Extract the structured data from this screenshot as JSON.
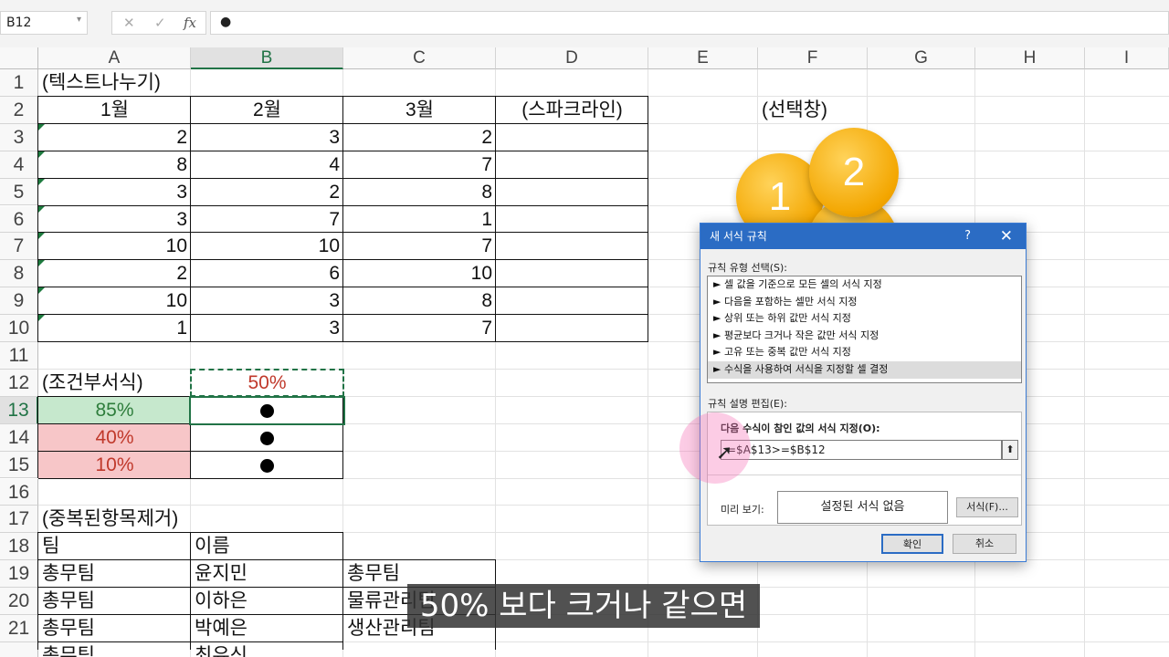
{
  "formula_bar": {
    "name_box": "B12",
    "cancel_icon": "✕",
    "enter_icon": "✓",
    "fx_label": "fx",
    "content": "●"
  },
  "columns": [
    "A",
    "B",
    "C",
    "D",
    "E",
    "F",
    "G",
    "H",
    "I"
  ],
  "rows": [
    "1",
    "2",
    "3",
    "4",
    "5",
    "6",
    "7",
    "8",
    "9",
    "10",
    "11",
    "12",
    "13",
    "14",
    "15",
    "16",
    "17",
    "18",
    "19",
    "20",
    "21",
    ""
  ],
  "cells": {
    "a1": "(텍스트나누기)",
    "b2": "1월",
    "c2": "2월",
    "d2": "3월",
    "e2": "(스파크라인)",
    "f2": "(선택창)",
    "r3": [
      "2",
      "3",
      "2"
    ],
    "r4": [
      "8",
      "4",
      "7"
    ],
    "r5": [
      "3",
      "2",
      "8"
    ],
    "r6": [
      "3",
      "7",
      "1"
    ],
    "r7": [
      "10",
      "10",
      "7"
    ],
    "r8": [
      "2",
      "6",
      "10"
    ],
    "r9": [
      "10",
      "3",
      "8"
    ],
    "r10": [
      "1",
      "3",
      "7"
    ],
    "a12": "(조건부서식)",
    "b12": "50%",
    "a13": "85%",
    "b13": "●",
    "a14": "40%",
    "b14": "●",
    "a15": "10%",
    "b15": "●",
    "a17": "(중복된항목제거)",
    "a18": "팀",
    "b18": "이름",
    "a19": "총무팀",
    "b19": "윤지민",
    "c19": "총무팀",
    "a20": "총무팀",
    "b20": "이하은",
    "c20": "물류관리팀",
    "a21": "총무팀",
    "b21": "박예은",
    "c21": "생산관리팀",
    "a22": "총무팀",
    "b22": "최유신"
  },
  "circles": [
    "1",
    "2"
  ],
  "dialog": {
    "title": "새 서식 규칙",
    "help": "?",
    "close": "✕",
    "rule_type_label": "규칙 유형 선택(S):",
    "rule_types": [
      "► 셀 값을 기준으로 모든 셀의 서식 지정",
      "► 다음을 포함하는 셀만 서식 지정",
      "► 상위 또는 하위 값만 서식 지정",
      "► 평균보다 크거나 작은 값만 서식 지정",
      "► 고유 또는 중복 값만 서식 지정",
      "► 수식을 사용하여 서식을 지정할 셀 결정"
    ],
    "edit_label": "규칙 설명 편집(E):",
    "formula_label": "다음 수식이 참인 값의 서식 지정(O):",
    "formula_value": "=$A$13>=$B$12",
    "collapse_icon": "⬆",
    "preview_label": "미리 보기:",
    "preview_text": "설정된 서식 없음",
    "format_button": "서식(F)...",
    "ok_button": "확인",
    "cancel_button": "취소"
  },
  "caption": "50% 보다 크거나 같으면",
  "colors": {
    "green_fill": "#c6e8cd",
    "green_text": "#2e7d3c",
    "red_fill": "#f7c6c8",
    "red_text": "#c0392b",
    "dialog_title": "#2b6cc4"
  }
}
